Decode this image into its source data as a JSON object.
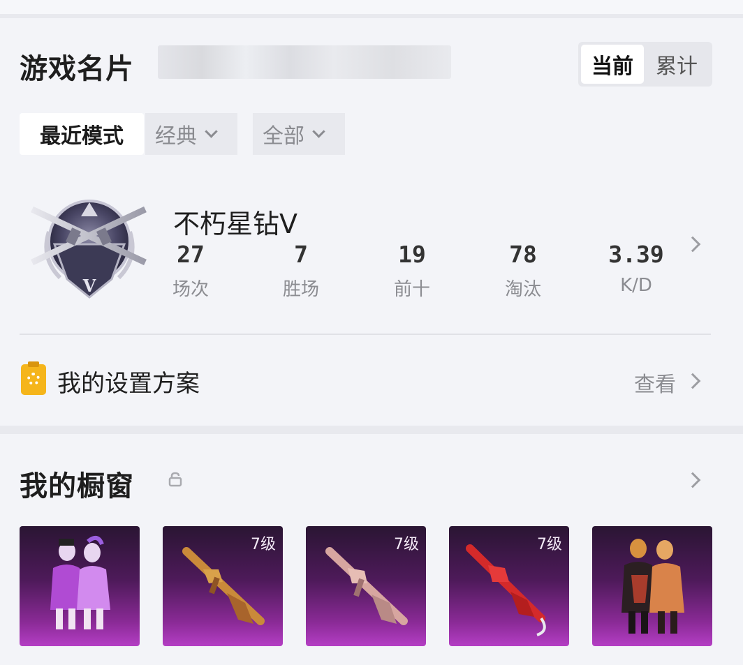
{
  "card": {
    "title": "游戏名片",
    "scope_tabs": [
      {
        "label": "当前",
        "active": true
      },
      {
        "label": "累计",
        "active": false
      }
    ],
    "filters": {
      "recent_mode": "最近模式",
      "mode_select": "经典",
      "range_select": "全部"
    },
    "rank": {
      "name": "不朽星钻Ⅴ",
      "badge_tier": "V"
    },
    "stats": [
      {
        "value": "27",
        "label": "场次"
      },
      {
        "value": "7",
        "label": "胜场"
      },
      {
        "value": "19",
        "label": "前十"
      },
      {
        "value": "78",
        "label": "淘汰"
      },
      {
        "value": "3.39",
        "label": "K/D"
      }
    ],
    "settings": {
      "label": "我的设置方案",
      "link": "查看"
    }
  },
  "showcase": {
    "title": "我的橱窗",
    "items": [
      {
        "kind": "outfit-pair",
        "level": ""
      },
      {
        "kind": "rifle-gold",
        "level": "7级"
      },
      {
        "kind": "rifle-pink",
        "level": "7级"
      },
      {
        "kind": "rifle-red",
        "level": "7级"
      },
      {
        "kind": "outfit-pair-dark",
        "level": ""
      }
    ]
  },
  "colors": {
    "page_bg": "#e8e9ee",
    "card_bg": "#f3f4f8",
    "accent_item": "#8a2a96",
    "settings_icon": "#f5b51b"
  },
  "icons": [
    "chevron-down-icon",
    "chevron-right-icon",
    "settings-clipboard-icon",
    "lock-icon"
  ]
}
